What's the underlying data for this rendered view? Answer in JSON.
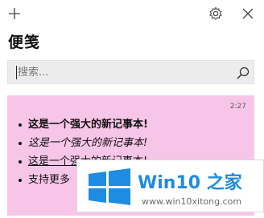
{
  "titlebar": {
    "add_icon": "plus-icon",
    "settings_icon": "gear-icon",
    "close_icon": "close-icon"
  },
  "app": {
    "title": "便笺"
  },
  "search": {
    "placeholder": "搜索...",
    "value": "",
    "icon": "search-icon"
  },
  "note": {
    "color": "#f7c5e8",
    "time": "2:27",
    "lines": [
      "这是一个强大的新记事本!",
      "这是一个强大的新记事本!",
      "这是一个强大的新记事本!",
      "支持更多"
    ]
  },
  "watermark": {
    "title": "Win10 之家",
    "subtitle": "www.win10xitong.com",
    "logo_icon": "windows-logo-icon",
    "accent": "#1e8ce0"
  }
}
